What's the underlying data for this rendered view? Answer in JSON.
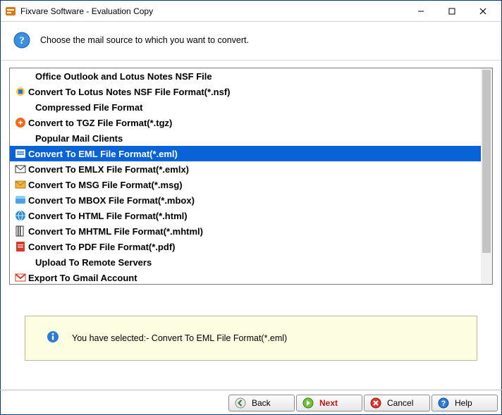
{
  "window": {
    "title": "Fixvare Software - Evaluation Copy"
  },
  "header": {
    "instruction": "Choose the mail source to which you want to convert."
  },
  "list": [
    {
      "kind": "group",
      "label": "Office Outlook and Lotus Notes NSF File",
      "icon": "none"
    },
    {
      "kind": "item",
      "label": "Convert To Lotus Notes NSF File Format(*.nsf)",
      "icon": "nsf"
    },
    {
      "kind": "group",
      "label": "Compressed File Format",
      "icon": "none"
    },
    {
      "kind": "item",
      "label": "Convert to TGZ File Format(*.tgz)",
      "icon": "tgz"
    },
    {
      "kind": "group",
      "label": "Popular Mail Clients",
      "icon": "none"
    },
    {
      "kind": "item",
      "label": "Convert To EML File Format(*.eml)",
      "icon": "eml",
      "selected": true
    },
    {
      "kind": "item",
      "label": "Convert To EMLX File Format(*.emlx)",
      "icon": "emlx"
    },
    {
      "kind": "item",
      "label": "Convert To MSG File Format(*.msg)",
      "icon": "msg"
    },
    {
      "kind": "item",
      "label": "Convert To MBOX File Format(*.mbox)",
      "icon": "mbox"
    },
    {
      "kind": "item",
      "label": "Convert To HTML File Format(*.html)",
      "icon": "html"
    },
    {
      "kind": "item",
      "label": "Convert To MHTML File Format(*.mhtml)",
      "icon": "mhtml"
    },
    {
      "kind": "item",
      "label": "Convert To PDF File Format(*.pdf)",
      "icon": "pdf"
    },
    {
      "kind": "group",
      "label": "Upload To Remote Servers",
      "icon": "none"
    },
    {
      "kind": "item",
      "label": "Export To Gmail Account",
      "icon": "gmail"
    }
  ],
  "status": {
    "message": "You have selected:- Convert To EML File Format(*.eml)"
  },
  "footer": {
    "back": "Back",
    "next": "Next",
    "cancel": "Cancel",
    "help": "Help"
  }
}
